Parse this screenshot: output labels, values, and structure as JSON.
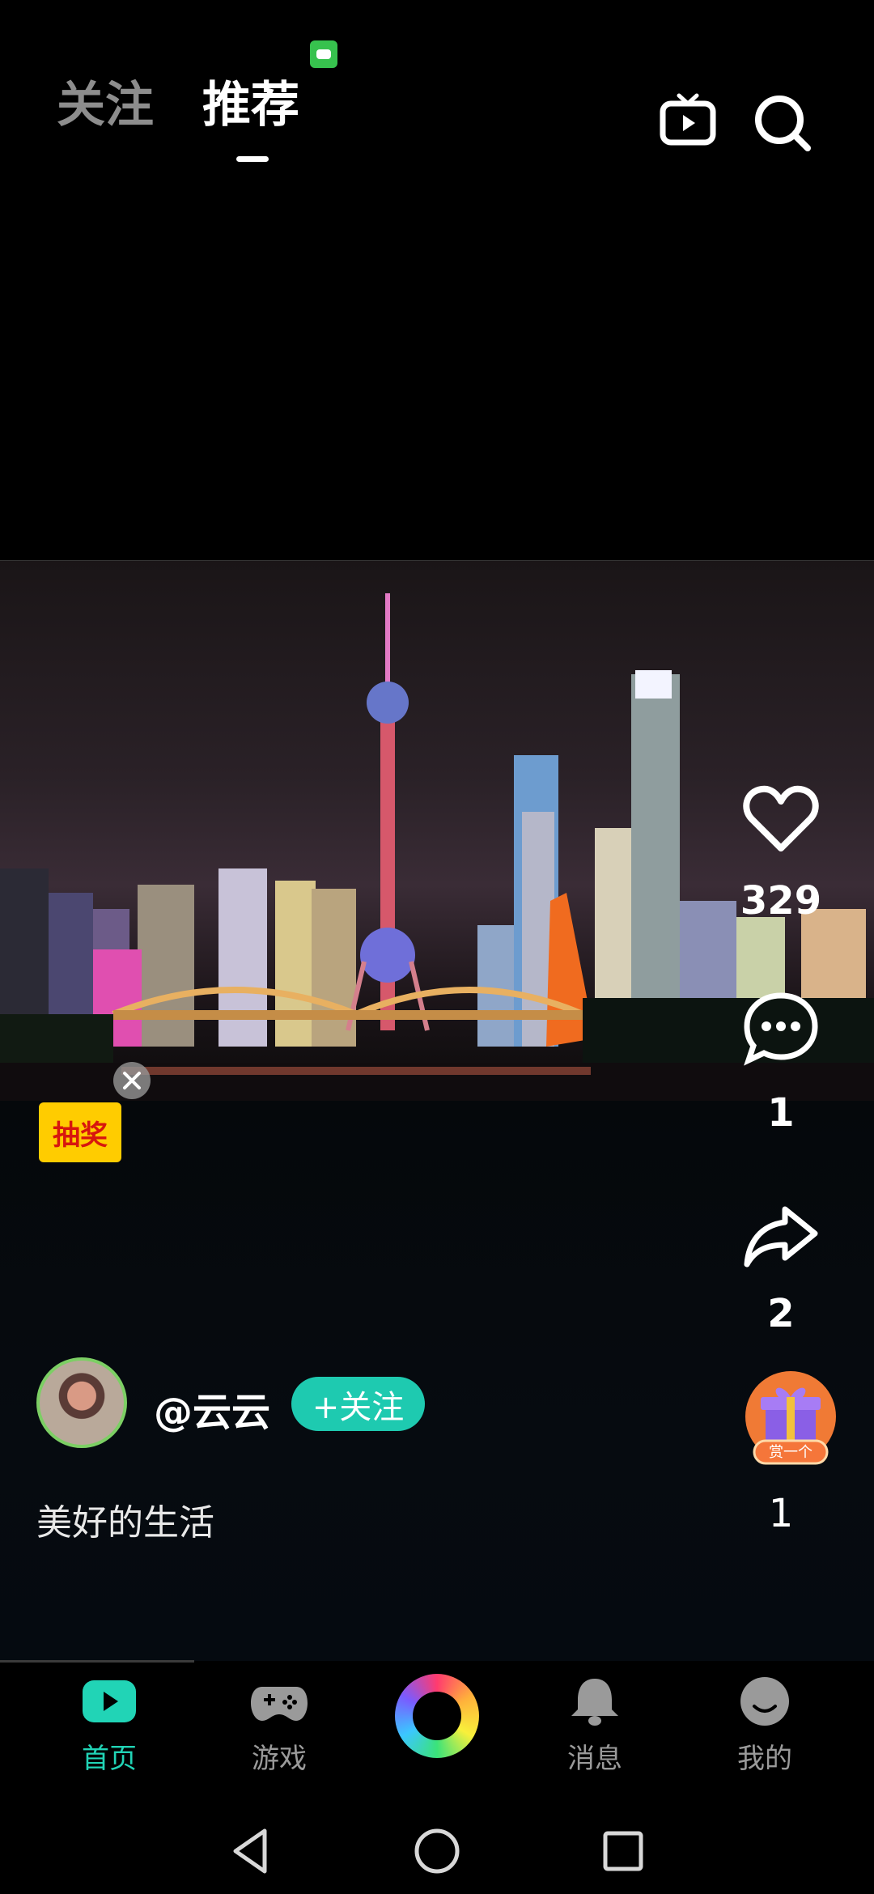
{
  "header": {
    "tabs": [
      {
        "label": "关注",
        "active": false
      },
      {
        "label": "推荐",
        "active": true
      }
    ],
    "icons": [
      "tv-icon",
      "search-icon"
    ]
  },
  "video": {
    "subject": "Shanghai skyline at night",
    "badge": "抽奖",
    "close_icon": "close-icon"
  },
  "actions": {
    "likes": "329",
    "comments": "1",
    "shares": "2",
    "gift_label": "赏一个",
    "gifts": "1"
  },
  "author": {
    "username": "@云云",
    "follow_label": "+关注",
    "caption": "美好的生活"
  },
  "nav": {
    "items": [
      {
        "label": "首页",
        "icon": "home-play-icon",
        "active": true
      },
      {
        "label": "游戏",
        "icon": "gamepad-icon",
        "active": false
      },
      {
        "label": "",
        "icon": "create-ring-icon",
        "active": false
      },
      {
        "label": "消息",
        "icon": "bell-icon",
        "active": false
      },
      {
        "label": "我的",
        "icon": "profile-face-icon",
        "active": false
      }
    ]
  },
  "colors": {
    "accent": "#1ecab0",
    "active_nav": "#21d4b6",
    "badge": "#ffcc00",
    "background": "#000000"
  }
}
